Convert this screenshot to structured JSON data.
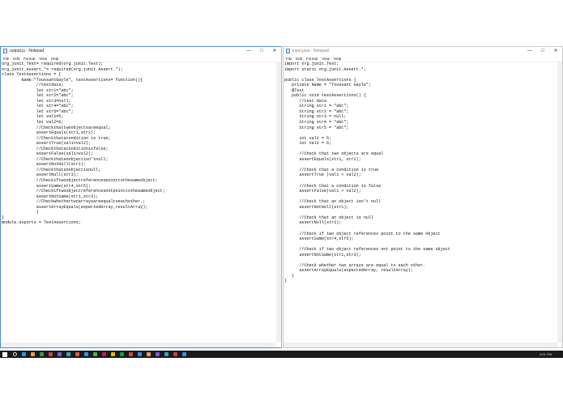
{
  "left_window": {
    "title": "output.js - Notepad",
    "menu": [
      "File",
      "Edit",
      "Format",
      "View",
      "Help"
    ],
    "content": "org_junit_Test= required(org.junit.Test);\norg_junit_Assert_*= required(org.junit.Assert.*);\nclass TestAssertions = {\n        Name:\"ToussantGayle\", testAssertions= function(){\n              //testdata;\n              let str1=\"abc\";\n              let str2=\"abc\";\n              let str3=null;\n              let str4=\"abc\";\n              let str5=\"abc\";\n              let val1=5;\n              let val2=6;\n              //Checkthattwoobjectsareequal;\n              assertEquals(str1,str2);\n              //Checkthatacondition is true;\n              assertTrue(val1<val2);\n              //Checkthataconditionisfalse;\n              assertFalse(val1>val2);\n              //Checkthatanobjectisn'tnull;\n              assertNotNull(str1);\n              //Checkthatanobjectisnull;\n              assertNull(str3);\n              //Checkiftwoobjectreferencespointtothesameobject;\n              assertSame(str4,str5);\n              //Checkiftwoobjectreferencesnotpointtothesameobject;\n              assertNotSame(str1,str3);\n              //Checkwhethertwoarraysareequaltoeachother.;\n              assertArrayEquals(expectedArray,resultArray);\n              }\n}\nmodule.exports = TestAssertions;"
  },
  "right_window": {
    "title": "input.java - Notepad",
    "menu": [
      "File",
      "Edit",
      "Format",
      "View",
      "Help"
    ],
    "content": "import org.junit.Test;\nimport static org.junit.Assert.*;\n\npublic class TestAssertions {\n   private Name = \"Toussant Gayle\";\n   @Test\n   public void testAssertions() {\n      //test data\n      String str1 = \"abc\";\n      String str2 = \"abc\";\n      String str3 = null;\n      String str4 = \"abc\";\n      String str5 = \"abc\";\n\n      int val1 = 5;\n      int val2 = 6;\n\n      //Check that two objects are equal\n      assertEquals(str1, str2);\n\n      //Check that a condition is true\n      assertTrue (val1 < val2);\n\n      //Check that a condition is false\n      assertFalse(val1 > val2);\n\n      //Check that an object isn't null\n      assertNotNull(str1);\n\n      //Check that an object is null\n      assertNull(str3);\n\n      //Check if two object references point to the same object\n      assertSame(str4,str5);\n\n      //Check if two object references not point to the same object\n      assertNotSame(str1,str3);\n\n      //Check whether two arrays are equal to each other.\n      assertArrayEquals(expectedArray, resultArray);\n   }\n}"
  },
  "taskbar": {
    "icon_colors": [
      "#3c8ee8",
      "#e8a33c",
      "#2d9c4c",
      "#d04040",
      "#7b5cd6",
      "#2aa8c4",
      "#e05c2a",
      "#3c8ee8",
      "#4caf50",
      "#c2185b",
      "#f4b400",
      "#0f9d58",
      "#db4437",
      "#4285f4",
      "#e8a33c",
      "#7b5cd6",
      "#2aa8c4",
      "#d04040",
      "#3c8ee8"
    ],
    "time": "4:51 PM"
  }
}
